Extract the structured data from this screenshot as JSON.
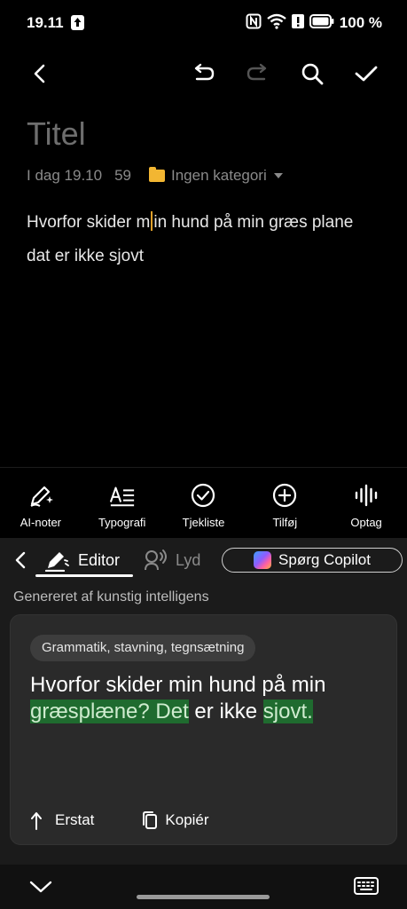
{
  "status_bar": {
    "time": "19.11",
    "battery": "100 %"
  },
  "note": {
    "title": "Titel",
    "date": "I dag 19.10",
    "count": "59",
    "category": "Ingen kategori",
    "body_before_cursor": "Hvorfor skider m",
    "body_after_cursor": "in hund på min græs plane dat er ikke sjovt"
  },
  "toolbar": {
    "items": [
      {
        "label": "AI-noter",
        "icon": "pen-sparkle-icon"
      },
      {
        "label": "Typografi",
        "icon": "typography-icon"
      },
      {
        "label": "Tjekliste",
        "icon": "check-circle-icon"
      },
      {
        "label": "Tilføj",
        "icon": "plus-circle-icon"
      },
      {
        "label": "Optag",
        "icon": "waveform-icon"
      }
    ]
  },
  "ai_panel": {
    "tab_editor": "Editor",
    "tab_audio": "Lyd",
    "copilot_button": "Spørg Copilot",
    "caption": "Genereret af kunstig intelligens",
    "chip": "Grammatik, stavning, tegnsætning",
    "result": {
      "plain_1": "Hvorfor skider min hund på min ",
      "highlight_1": "græsplæne? Det",
      "plain_2": " er ikke ",
      "highlight_2": "sjovt."
    },
    "replace_label": "Erstat",
    "copy_label": "Kopiér"
  },
  "colors": {
    "accent_folder": "#f2b632",
    "highlight": "#1f6b2f",
    "panel": "#1b1b1b",
    "card": "#2a2a2a"
  }
}
